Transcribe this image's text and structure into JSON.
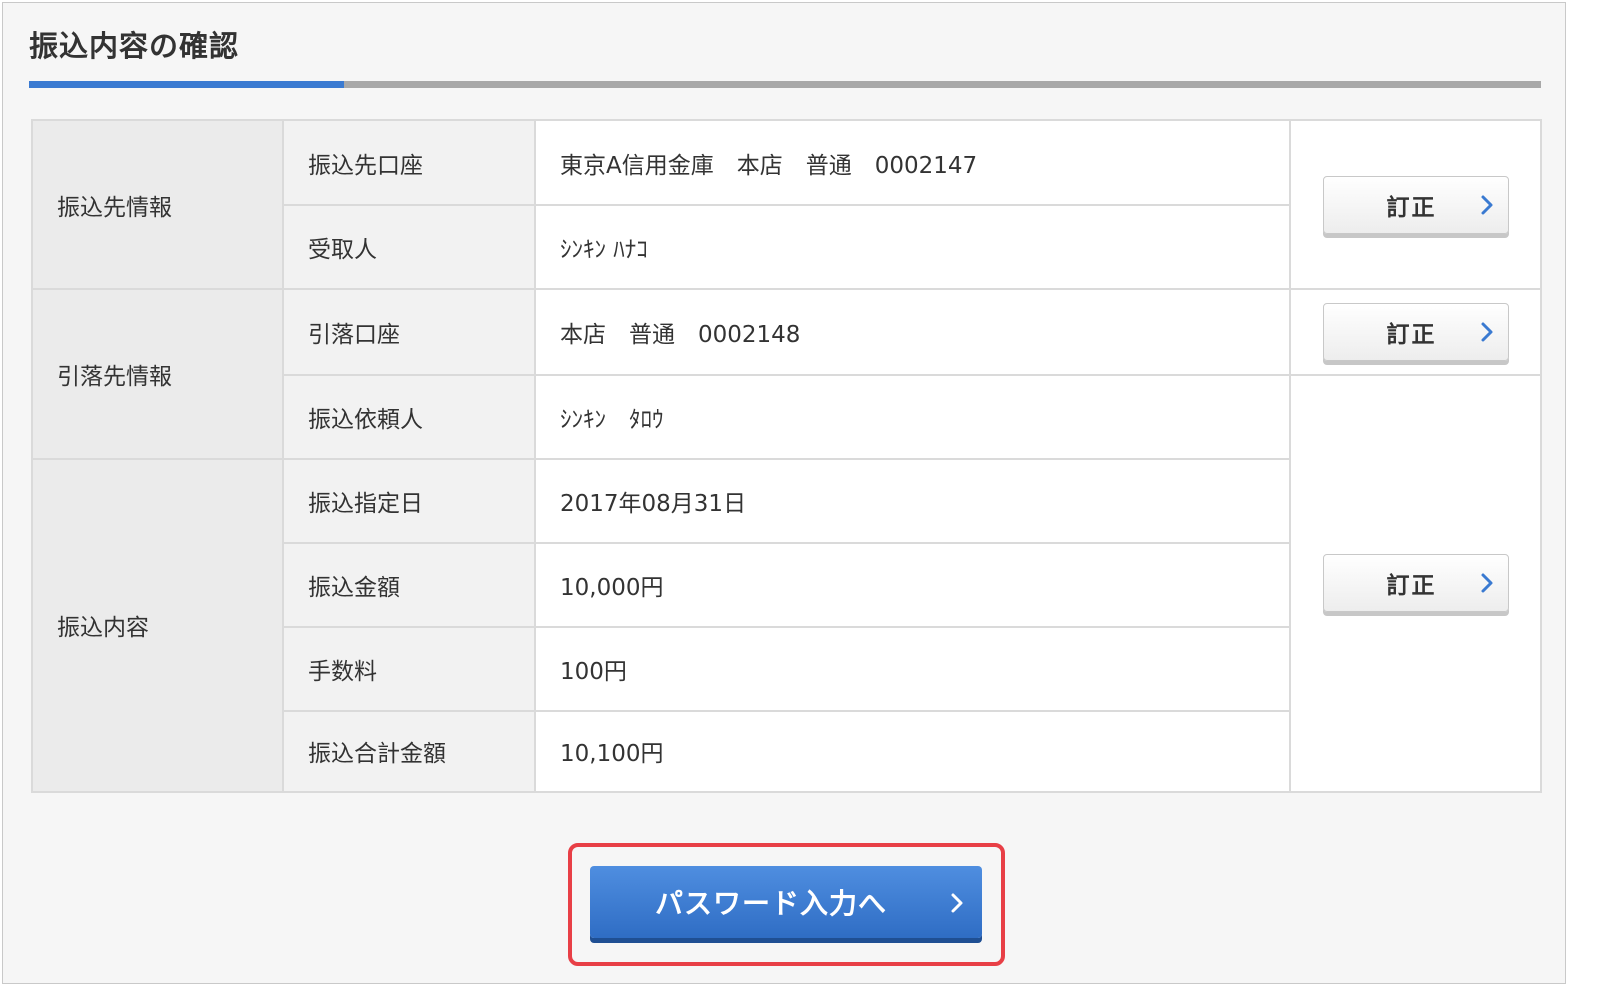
{
  "page": {
    "title": "振込内容の確認"
  },
  "table": {
    "sections": [
      {
        "category": "振込先情報",
        "rows": [
          {
            "label": "振込先口座",
            "value": "東京A信用金庫　本店　普通　0002147"
          },
          {
            "label": "受取人",
            "value": "ｼﾝｷﾝ ﾊﾅｺ"
          }
        ]
      },
      {
        "category": "引落先情報",
        "rows": [
          {
            "label": "引落口座",
            "value": "本店　普通　0002148"
          },
          {
            "label": "振込依頼人",
            "value": "ｼﾝｷﾝ　ﾀﾛｳ"
          }
        ]
      },
      {
        "category": "振込内容",
        "rows": [
          {
            "label": "振込指定日",
            "value": "2017年08月31日"
          },
          {
            "label": "振込金額",
            "value": "10,000円"
          },
          {
            "label": "手数料",
            "value": "100円"
          },
          {
            "label": "振込合計金額",
            "value": "10,100円"
          }
        ]
      }
    ],
    "fix_buttons": [
      {
        "label": "訂正"
      },
      {
        "label": "訂正"
      },
      {
        "label": "訂正"
      }
    ]
  },
  "cta": {
    "label": "パスワード入力へ"
  },
  "colors": {
    "accent": "#3a7ad1",
    "cta_blue": "#3a7bd5",
    "highlight_red": "#e83f46",
    "chevron_blue": "#3a7ad1"
  },
  "icons": {
    "fix_button_icon": "chevron-right-icon",
    "cta_icon": "chevron-right-icon"
  }
}
